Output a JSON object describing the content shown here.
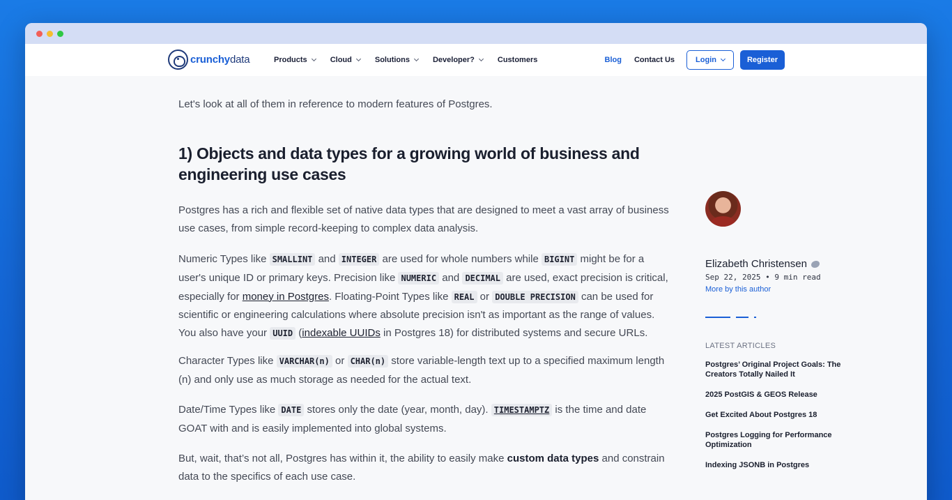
{
  "nav": {
    "logo_bold": "crunchy",
    "logo_light": "data",
    "menu": [
      {
        "label": "Products"
      },
      {
        "label": "Cloud"
      },
      {
        "label": "Solutions"
      },
      {
        "label": "Developer?"
      },
      {
        "label": "Customers"
      }
    ],
    "blog": "Blog",
    "contact": "Contact Us",
    "login": "Login",
    "register": "Register"
  },
  "article": {
    "intro": "Let's look at all of them in reference to modern features of Postgres.",
    "heading": "1) Objects and data types for a growing world of business and engineering use cases",
    "p1": "Postgres has a rich and flexible set of native data types that are designed to meet a vast array of business use cases, from simple record-keeping to complex data analysis.",
    "p2": {
      "t1": "Numeric Types like ",
      "c1": "SMALLINT",
      "t2": " and ",
      "c2": "INTEGER",
      "t3": " are used for whole numbers while ",
      "c3": "BIGINT",
      "t4": " might be for a user's unique ID or primary keys. Precision like ",
      "c4": "NUMERIC",
      "t5": " and ",
      "c5": "DECIMAL",
      "t6": " are used, exact precision is critical, especially for ",
      "link1": "money in Postgres",
      "t7": ". Floating-Point Types like ",
      "c6": "REAL",
      "t8": " or ",
      "c7": "DOUBLE PRECISION",
      "t9": " can be used for scientific or engineering calculations where absolute precision isn't as important as the range of values. You also have your ",
      "c8": "UUID",
      "t10": " (",
      "link2": "indexable UUIDs",
      "t11": " in Postgres 18) for distributed systems and secure URLs."
    },
    "p3": {
      "t1": "Character Types like ",
      "c1": "VARCHAR(n)",
      "t2": " or ",
      "c2": "CHAR(n)",
      "t3": " store variable-length text up to a specified maximum length (n) and only use as much storage as needed for the actual text."
    },
    "p4": {
      "t1": "Date/Time Types like ",
      "c1": "DATE",
      "t2": " stores only the date (year, month, day).  ",
      "c2": "TIMESTAMPTZ",
      "t3": " is the time and date GOAT with and is easily implemented into global systems."
    },
    "p5": {
      "t1": "But, wait, that’s not all, Postgres has within it, the ability to easily make ",
      "b1": "custom data types",
      "t2": " and constrain data to the specifics of each use case."
    }
  },
  "sidebar": {
    "author_name": "Elizabeth Christensen",
    "meta": "Sep 22, 2025 • 9 min read",
    "more": "More by this author",
    "latest_title": "LATEST ARTICLES",
    "latest": [
      "Postgres’ Original Project Goals: The Creators Totally Nailed It",
      "2025 PostGIS & GEOS Release",
      "Get Excited About Postgres 18",
      "Postgres Logging for Performance Optimization",
      "Indexing JSONB in Postgres"
    ]
  },
  "colors": {
    "accent": "#1a5fd6",
    "background": "#1466d6"
  }
}
